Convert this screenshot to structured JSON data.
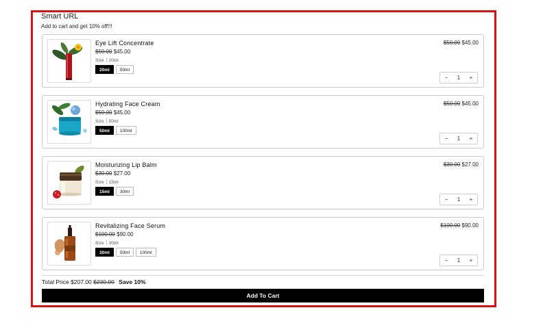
{
  "header": {
    "title": "Smart URL",
    "subtitle": "Add to cart and get 10% off!!!"
  },
  "products": [
    {
      "name": "Eye Lift Concentrate",
      "original_price": "$50.00",
      "price": "$45.00",
      "size_label": "Size",
      "size_value": "20ml",
      "options": [
        "20ml",
        "50ml"
      ],
      "selected": 0,
      "quantity": "1"
    },
    {
      "name": "Hydrating Face Cream",
      "original_price": "$50.00",
      "price": "$45.00",
      "size_label": "Size",
      "size_value": "50ml",
      "options": [
        "50ml",
        "100ml"
      ],
      "selected": 0,
      "quantity": "1"
    },
    {
      "name": "Moisturizing Lip Balm",
      "original_price": "$30.00",
      "price": "$27.00",
      "size_label": "Size",
      "size_value": "15ml",
      "options": [
        "15ml",
        "30ml"
      ],
      "selected": 0,
      "quantity": "1"
    },
    {
      "name": "Revitalizing Face Serum",
      "original_price": "$100.00",
      "price": "$90.00",
      "size_label": "Size",
      "size_value": "30ml",
      "options": [
        "30ml",
        "50ml",
        "100ml"
      ],
      "selected": 0,
      "quantity": "1"
    }
  ],
  "stepper": {
    "minus": "−",
    "plus": "+"
  },
  "footer": {
    "total_label": "Total Price",
    "total_price": "$207.00",
    "total_original": "$230.00",
    "save_text": "Save 10%",
    "button_label": "Add To Cart"
  },
  "colors": {
    "frame_border": "#e01010",
    "button_bg": "#000000",
    "selected_option_bg": "#000000"
  }
}
